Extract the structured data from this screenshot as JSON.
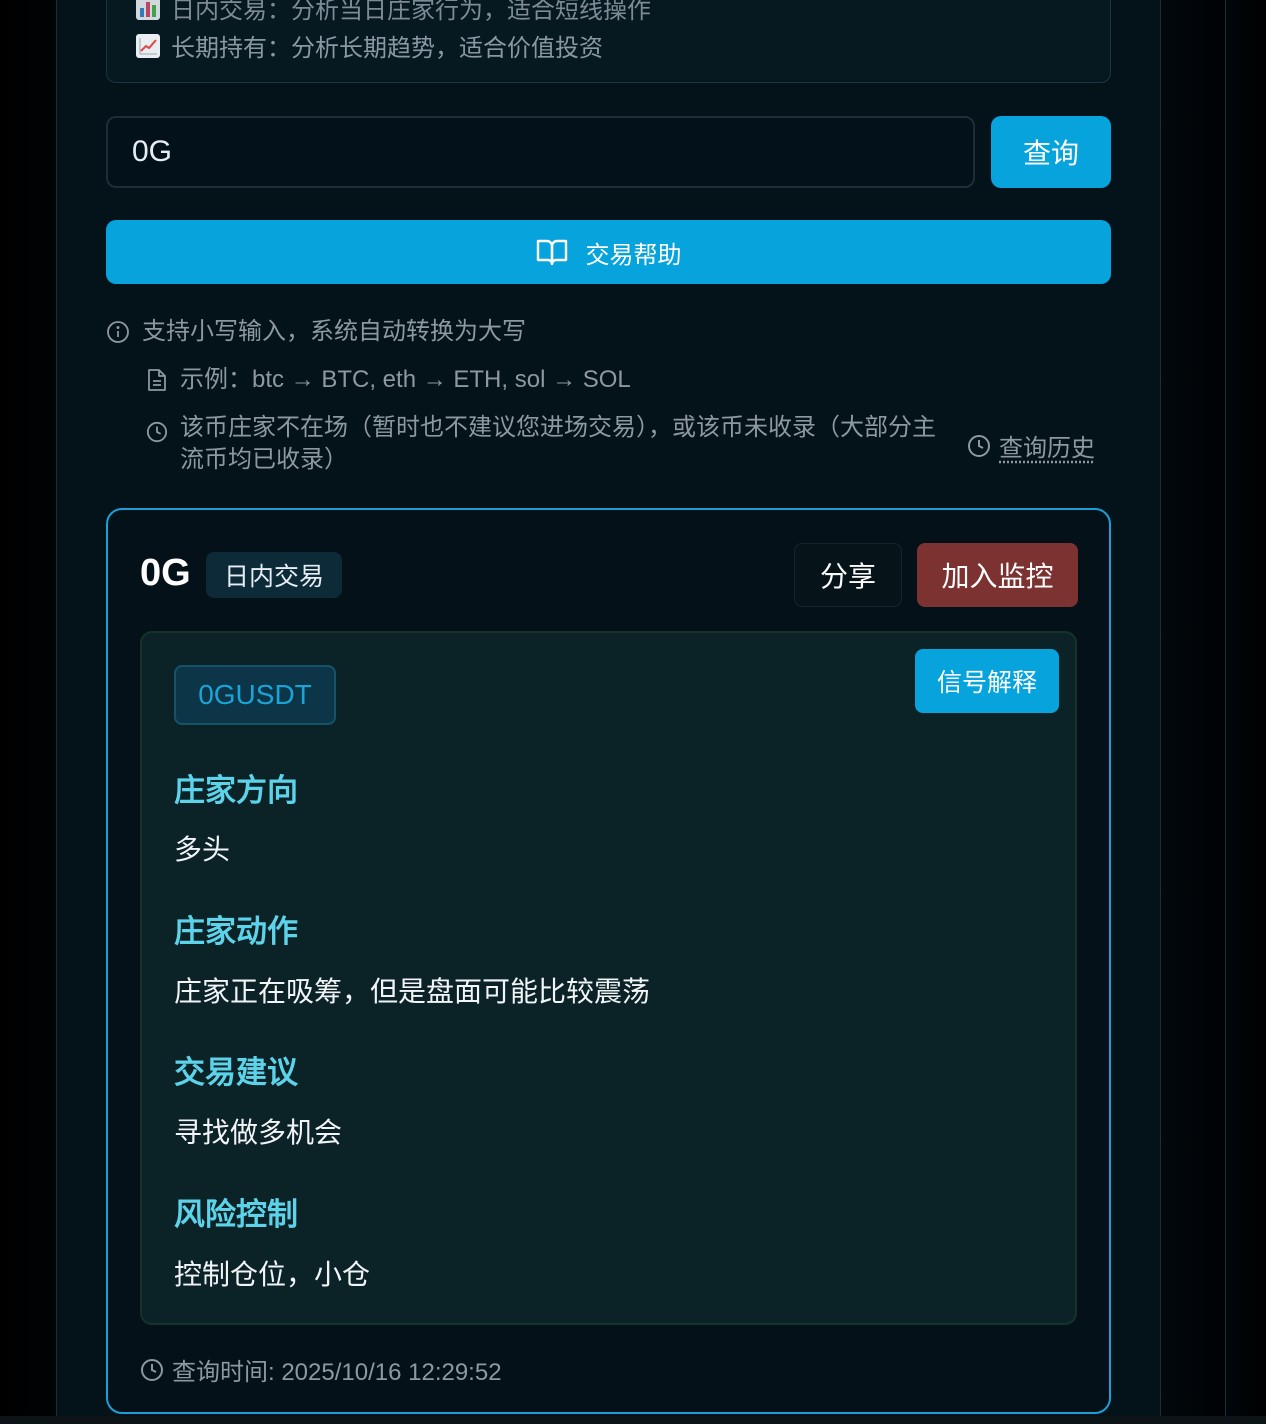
{
  "mode_info": {
    "intraday": {
      "icon": "bar-chart-emoji",
      "text": "日内交易：分析当日庄家行为，适合短线操作"
    },
    "longterm": {
      "icon": "chart-increasing-emoji",
      "text": "长期持有：分析长期趋势，适合价值投资"
    }
  },
  "search": {
    "value": "0G",
    "button_label": "查询"
  },
  "help_button": {
    "icon": "book-open-icon",
    "label": "交易帮助"
  },
  "hints": {
    "uppercase": "支持小写输入，系统自动转换为大写",
    "example": "示例：btc → BTC, eth → ETH, sol → SOL",
    "notice": "该币庄家不在场（暂时也不建议您进场交易），或该币未收录（大部分主流币均已收录）",
    "history_link": "查询历史"
  },
  "result": {
    "coin": "0G",
    "mode_tag": "日内交易",
    "share_label": "分享",
    "monitor_label": "加入监控",
    "pair": "0GUSDT",
    "explain_label": "信号解释",
    "sections": [
      {
        "label": "庄家方向",
        "value": "多头"
      },
      {
        "label": "庄家动作",
        "value": "庄家正在吸筹，但是盘面可能比较震荡"
      },
      {
        "label": "交易建议",
        "value": "寻找做多机会"
      },
      {
        "label": "风险控制",
        "value": "控制仓位，小仓"
      }
    ],
    "query_time": "查询时间: 2025/10/16 12:29:52"
  },
  "colors": {
    "accent": "#06a3dc",
    "monitor_button": "#7d3232",
    "section_label": "#5dd3ea",
    "card_border": "#1a9fd6"
  }
}
